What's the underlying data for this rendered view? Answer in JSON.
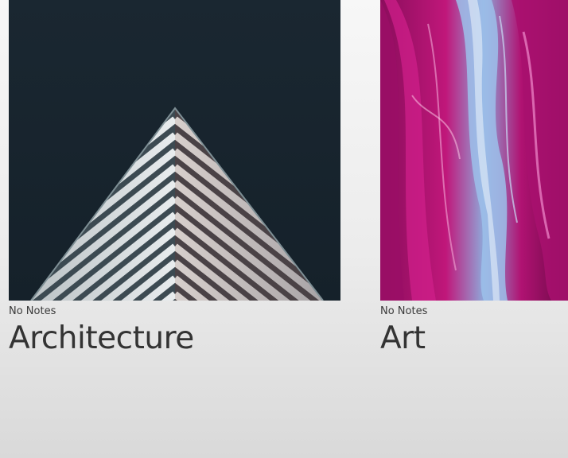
{
  "notebooks": [
    {
      "notes_label": "No Notes",
      "title": "Architecture",
      "cover": "architecture-photo"
    },
    {
      "notes_label": "No Notes",
      "title": "Art",
      "cover": "abstract-paint-photo"
    }
  ],
  "colors": {
    "architecture_sky": "#17232d",
    "art_magenta": "#b0106e",
    "art_blue": "#7fb1e0",
    "title_text": "#333333"
  }
}
